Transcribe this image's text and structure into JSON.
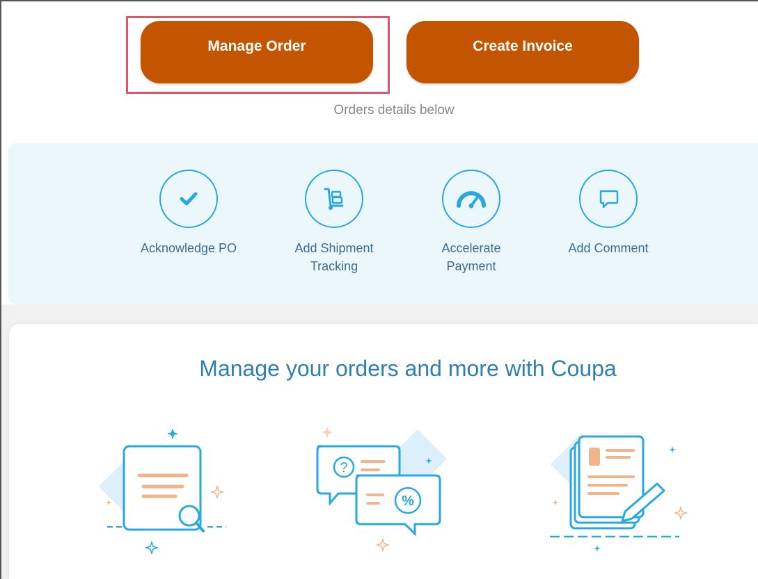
{
  "header": {
    "manage_order_label": "Manage Order",
    "create_invoice_label": "Create Invoice",
    "subtitle": "Orders details below"
  },
  "actions": [
    {
      "label_line1": "Acknowledge PO",
      "label_line2": "",
      "icon": "checkmark-icon"
    },
    {
      "label_line1": "Add Shipment",
      "label_line2": "Tracking",
      "icon": "hand-truck-icon"
    },
    {
      "label_line1": "Accelerate",
      "label_line2": "Payment",
      "icon": "speedometer-icon"
    },
    {
      "label_line1": "Add Comment",
      "label_line2": "",
      "icon": "speech-bubble-icon"
    }
  ],
  "promo": {
    "title": "Manage your orders and more with Coupa"
  },
  "colors": {
    "button": "#c45500",
    "highlight": "#e05563",
    "icon_blue": "#29a8e0",
    "panel_bg": "#ecf7fb",
    "title_blue": "#2f7fb0"
  }
}
